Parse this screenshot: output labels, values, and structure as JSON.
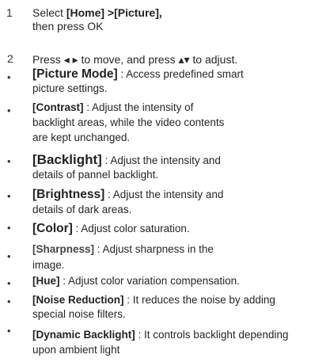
{
  "step1": {
    "number": "1",
    "prefix": "Select ",
    "path": "[Home] >[Picture],",
    "line2": "then press OK"
  },
  "step2": {
    "number": "2",
    "text": "Press ◂ ▸ to move, and press ▴▾  to adjust."
  },
  "items": [
    {
      "label": "[Picture Mode]",
      "desc1": " : Access predefined smart",
      "desc2": "picture settings."
    },
    {
      "label": "[Contrast]",
      "desc1": " : Adjust the intensity of",
      "desc2": "backlight areas, while the video contents",
      "desc3": "are kept unchanged."
    },
    {
      "label": "[Backlight]",
      "desc1": "  : Adjust the intensity and",
      "desc2": "details of pannel backlight."
    },
    {
      "label": "[Brightness]",
      "desc1": "  : Adjust the intensity and",
      "desc2": "details of dark areas."
    },
    {
      "label": "[Color]",
      "desc1": " : Adjust color saturation."
    },
    {
      "label": "[Sharpness]",
      "desc1": " : Adjust sharpness in the",
      "desc2": "image."
    },
    {
      "label": "[Hue]",
      "desc1": " : Adjust color variation compensation."
    },
    {
      "label": "[Noise Reduction]",
      "desc1": " : It reduces the noise by adding",
      "desc2": "special noise filters."
    },
    {
      "label": "[Dynamic Backlight]",
      "desc1": " : It controls backlight depending",
      "desc2": "upon ambient light"
    }
  ],
  "bullet_char": "•"
}
